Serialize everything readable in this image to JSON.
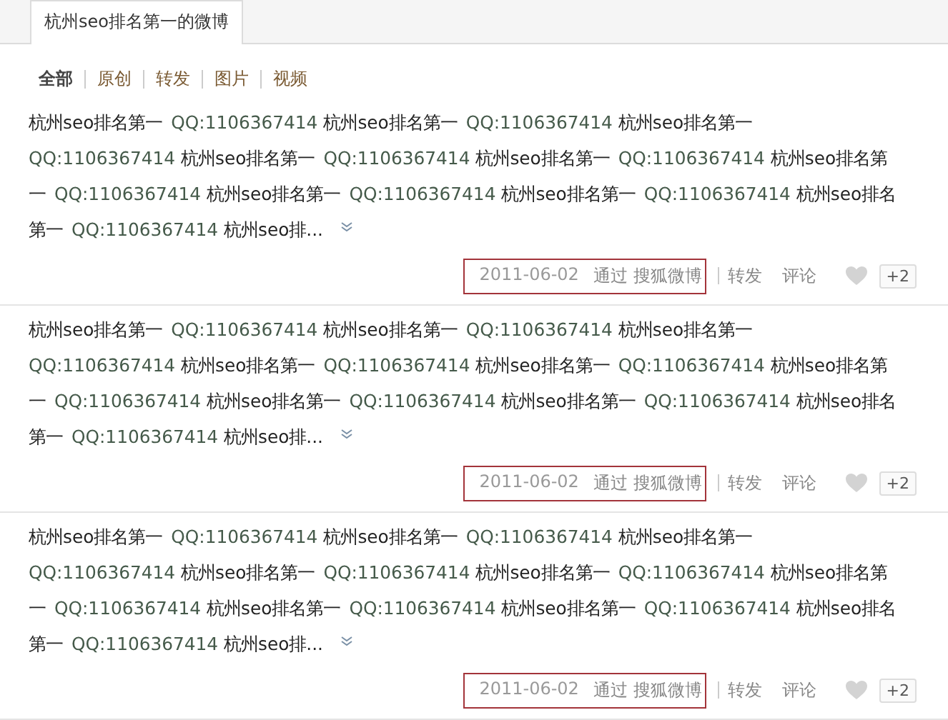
{
  "header_tab": {
    "label": "杭州seo排名第一的微博"
  },
  "filters": [
    {
      "label": "全部",
      "selected": true
    },
    {
      "label": "原创",
      "selected": false
    },
    {
      "label": "转发",
      "selected": false
    },
    {
      "label": "图片",
      "selected": false
    },
    {
      "label": "视频",
      "selected": false
    }
  ],
  "posts": [
    {
      "parts": [
        {
          "kind": "name",
          "text": "杭州seo排名第一"
        },
        {
          "kind": "qq",
          "text": "QQ:1106367414"
        },
        {
          "kind": "name",
          "text": "杭州seo排名第一"
        },
        {
          "kind": "qq",
          "text": "QQ:1106367414"
        },
        {
          "kind": "name",
          "text": "杭州seo排名第一"
        },
        {
          "kind": "qq",
          "text": "QQ:1106367414"
        },
        {
          "kind": "name",
          "text": "杭州seo排名第一"
        },
        {
          "kind": "qq",
          "text": "QQ:1106367414"
        },
        {
          "kind": "name",
          "text": "杭州seo排名第一"
        },
        {
          "kind": "qq",
          "text": "QQ:1106367414"
        },
        {
          "kind": "name",
          "text": "杭州seo排名第一"
        },
        {
          "kind": "qq",
          "text": "QQ:1106367414"
        },
        {
          "kind": "name",
          "text": "杭州seo排名第一"
        },
        {
          "kind": "qq",
          "text": "QQ:1106367414"
        },
        {
          "kind": "name",
          "text": "杭州seo排名第一"
        },
        {
          "kind": "qq",
          "text": "QQ:1106367414"
        },
        {
          "kind": "name",
          "text": "杭州seo排名第一"
        },
        {
          "kind": "qq",
          "text": "QQ:1106367414"
        },
        {
          "kind": "name",
          "text": "杭州seo排..."
        }
      ],
      "date": "2011-06-02",
      "source": "通过 搜狐微博",
      "repost": "转发",
      "comment": "评论",
      "plus": "+2"
    },
    {
      "parts": [
        {
          "kind": "name",
          "text": "杭州seo排名第一"
        },
        {
          "kind": "qq",
          "text": "QQ:1106367414"
        },
        {
          "kind": "name",
          "text": "杭州seo排名第一"
        },
        {
          "kind": "qq",
          "text": "QQ:1106367414"
        },
        {
          "kind": "name",
          "text": "杭州seo排名第一"
        },
        {
          "kind": "qq",
          "text": "QQ:1106367414"
        },
        {
          "kind": "name",
          "text": "杭州seo排名第一"
        },
        {
          "kind": "qq",
          "text": "QQ:1106367414"
        },
        {
          "kind": "name",
          "text": "杭州seo排名第一"
        },
        {
          "kind": "qq",
          "text": "QQ:1106367414"
        },
        {
          "kind": "name",
          "text": "杭州seo排名第一"
        },
        {
          "kind": "qq",
          "text": "QQ:1106367414"
        },
        {
          "kind": "name",
          "text": "杭州seo排名第一"
        },
        {
          "kind": "qq",
          "text": "QQ:1106367414"
        },
        {
          "kind": "name",
          "text": "杭州seo排名第一"
        },
        {
          "kind": "qq",
          "text": "QQ:1106367414"
        },
        {
          "kind": "name",
          "text": "杭州seo排名第一"
        },
        {
          "kind": "qq",
          "text": "QQ:1106367414"
        },
        {
          "kind": "name",
          "text": "杭州seo排..."
        }
      ],
      "date": "2011-06-02",
      "source": "通过 搜狐微博",
      "repost": "转发",
      "comment": "评论",
      "plus": "+2"
    },
    {
      "parts": [
        {
          "kind": "name",
          "text": "杭州seo排名第一"
        },
        {
          "kind": "qq",
          "text": "QQ:1106367414"
        },
        {
          "kind": "name",
          "text": "杭州seo排名第一"
        },
        {
          "kind": "qq",
          "text": "QQ:1106367414"
        },
        {
          "kind": "name",
          "text": "杭州seo排名第一"
        },
        {
          "kind": "qq",
          "text": "QQ:1106367414"
        },
        {
          "kind": "name",
          "text": "杭州seo排名第一"
        },
        {
          "kind": "qq",
          "text": "QQ:1106367414"
        },
        {
          "kind": "name",
          "text": "杭州seo排名第一"
        },
        {
          "kind": "qq",
          "text": "QQ:1106367414"
        },
        {
          "kind": "name",
          "text": "杭州seo排名第一"
        },
        {
          "kind": "qq",
          "text": "QQ:1106367414"
        },
        {
          "kind": "name",
          "text": "杭州seo排名第一"
        },
        {
          "kind": "qq",
          "text": "QQ:1106367414"
        },
        {
          "kind": "name",
          "text": "杭州seo排名第一"
        },
        {
          "kind": "qq",
          "text": "QQ:1106367414"
        },
        {
          "kind": "name",
          "text": "杭州seo排名第一"
        },
        {
          "kind": "qq",
          "text": "QQ:1106367414"
        },
        {
          "kind": "name",
          "text": "杭州seo排..."
        }
      ],
      "date": "2011-06-02",
      "source": "通过 搜狐微博",
      "repost": "转发",
      "comment": "评论",
      "plus": "+2"
    }
  ]
}
